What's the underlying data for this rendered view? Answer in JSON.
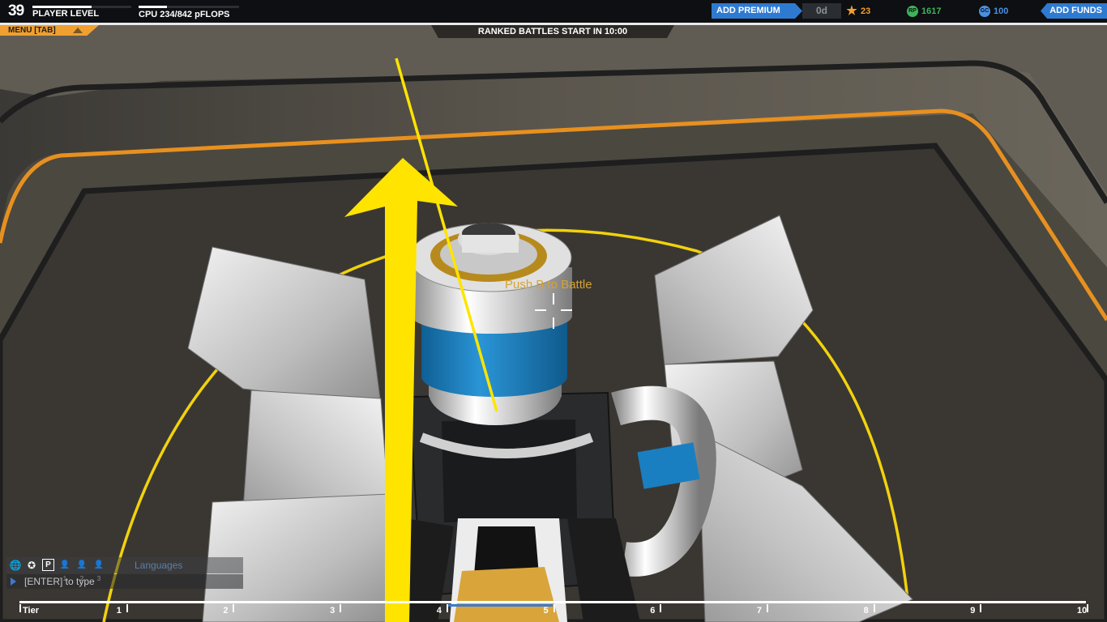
{
  "header": {
    "player_level_value": "39",
    "player_level_label": "PLAYER LEVEL",
    "player_level_progress": 0.6,
    "cpu_label": "CPU 234/842 pFLOPS",
    "cpu_progress": 0.28,
    "menu_label": "MENU [TAB]",
    "ranked_text": "RANKED BATTLES START IN 10:00",
    "premium_label": "ADD PREMIUM",
    "premium_days": "0d",
    "stars_value": "23",
    "rp_value": "1617",
    "rp_icon_text": "RP",
    "gc_value": "100",
    "gc_icon_text": "GC",
    "add_funds_label": "ADD FUNDS"
  },
  "center": {
    "prompt": "Push B to Battle"
  },
  "chat": {
    "icons": [
      "globe-icon",
      "accessibility-icon",
      "party-icon",
      "user-1-icon",
      "user-2-icon",
      "user-3-icon"
    ],
    "icon_labels": [
      "P",
      "1",
      "2",
      "3"
    ],
    "languages_label": "Languages",
    "input_placeholder": "[ENTER] to type"
  },
  "tier_bar": {
    "label": "Tier",
    "ticks": [
      "1",
      "2",
      "3",
      "4",
      "5",
      "6",
      "7",
      "8",
      "9",
      "10"
    ],
    "progress_fraction": 0.1
  },
  "colors": {
    "accent_orange": "#f0a030",
    "premium_blue": "#2f7ad1",
    "arrow_yellow": "#ffe400",
    "ring_yellow": "#f2d20c",
    "cube_white": "#d9d9d9",
    "robot_blue": "#1a7fc1"
  }
}
